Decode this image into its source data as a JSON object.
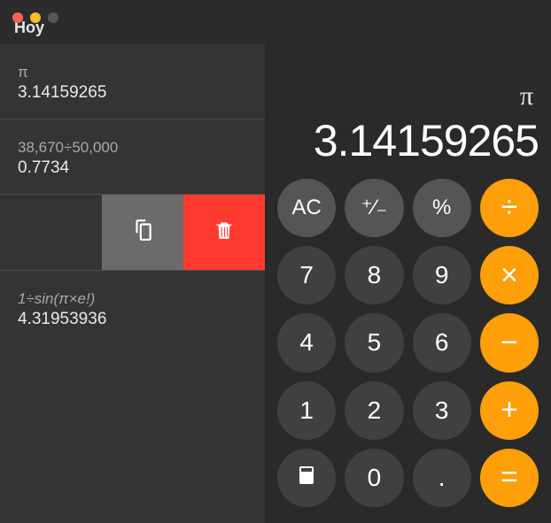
{
  "window": {
    "close": "close",
    "minimize": "minimize",
    "maximize": "maximize"
  },
  "sidebar": {
    "title": "Hoy",
    "entries": [
      {
        "expression": "π",
        "result": "3.14159265"
      },
      {
        "expression": "38,670÷50,000",
        "result": "0.7734"
      },
      {
        "expression": "1÷sin(π×e!)",
        "result": "4.31953936"
      }
    ],
    "actions": {
      "copy": "copy",
      "delete": "delete"
    }
  },
  "display": {
    "symbol": "π",
    "value": "3.14159265"
  },
  "keys": {
    "ac": "AC",
    "sign": "⁺∕₋",
    "percent": "%",
    "divide": "÷",
    "k7": "7",
    "k8": "8",
    "k9": "9",
    "multiply": "×",
    "k4": "4",
    "k5": "5",
    "k6": "6",
    "minus": "−",
    "k1": "1",
    "k2": "2",
    "k3": "3",
    "plus": "+",
    "k0": "0",
    "decimal": ".",
    "equals": "="
  }
}
